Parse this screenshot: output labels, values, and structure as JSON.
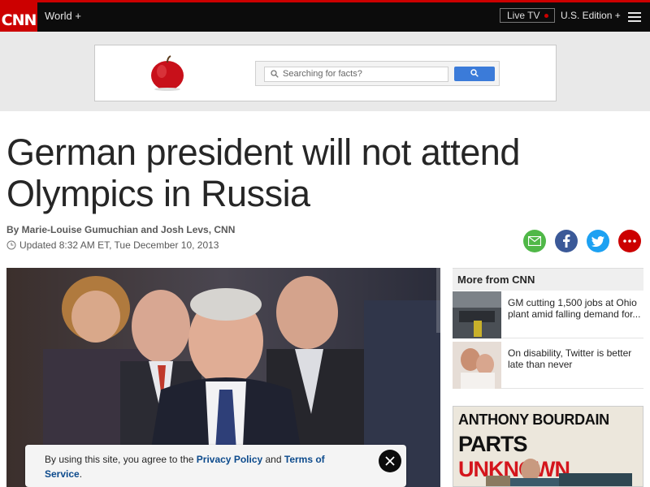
{
  "nav": {
    "logo": "CNN",
    "world": "World +",
    "live_tv": "Live TV",
    "edition": "U.S. Edition +"
  },
  "ad": {
    "search_placeholder": "Searching for facts?"
  },
  "article": {
    "headline": "German president will not attend Olympics in Russia",
    "byline": "By Marie-Louise Gumuchian and Josh Levs, CNN",
    "updated": "Updated 8:32 AM ET, Tue December 10, 2013"
  },
  "cookie": {
    "text_prefix": "By using this site, you agree to the ",
    "privacy_link": "Privacy Policy",
    "and": " and ",
    "terms_link": "Terms of Service",
    "suffix": "."
  },
  "sidebar": {
    "title": "More from CNN",
    "items": [
      {
        "text": "GM cutting 1,500 jobs at Ohio plant amid falling demand for..."
      },
      {
        "text": "On disability, Twitter is better late than never"
      }
    ],
    "promo_line1": "ANTHONY BOURDAIN",
    "promo_parts": "PARTS",
    "promo_unknown": "UNKNOWN"
  },
  "colors": {
    "brand_red": "#cc0000",
    "link_blue": "#0c4a8c"
  }
}
